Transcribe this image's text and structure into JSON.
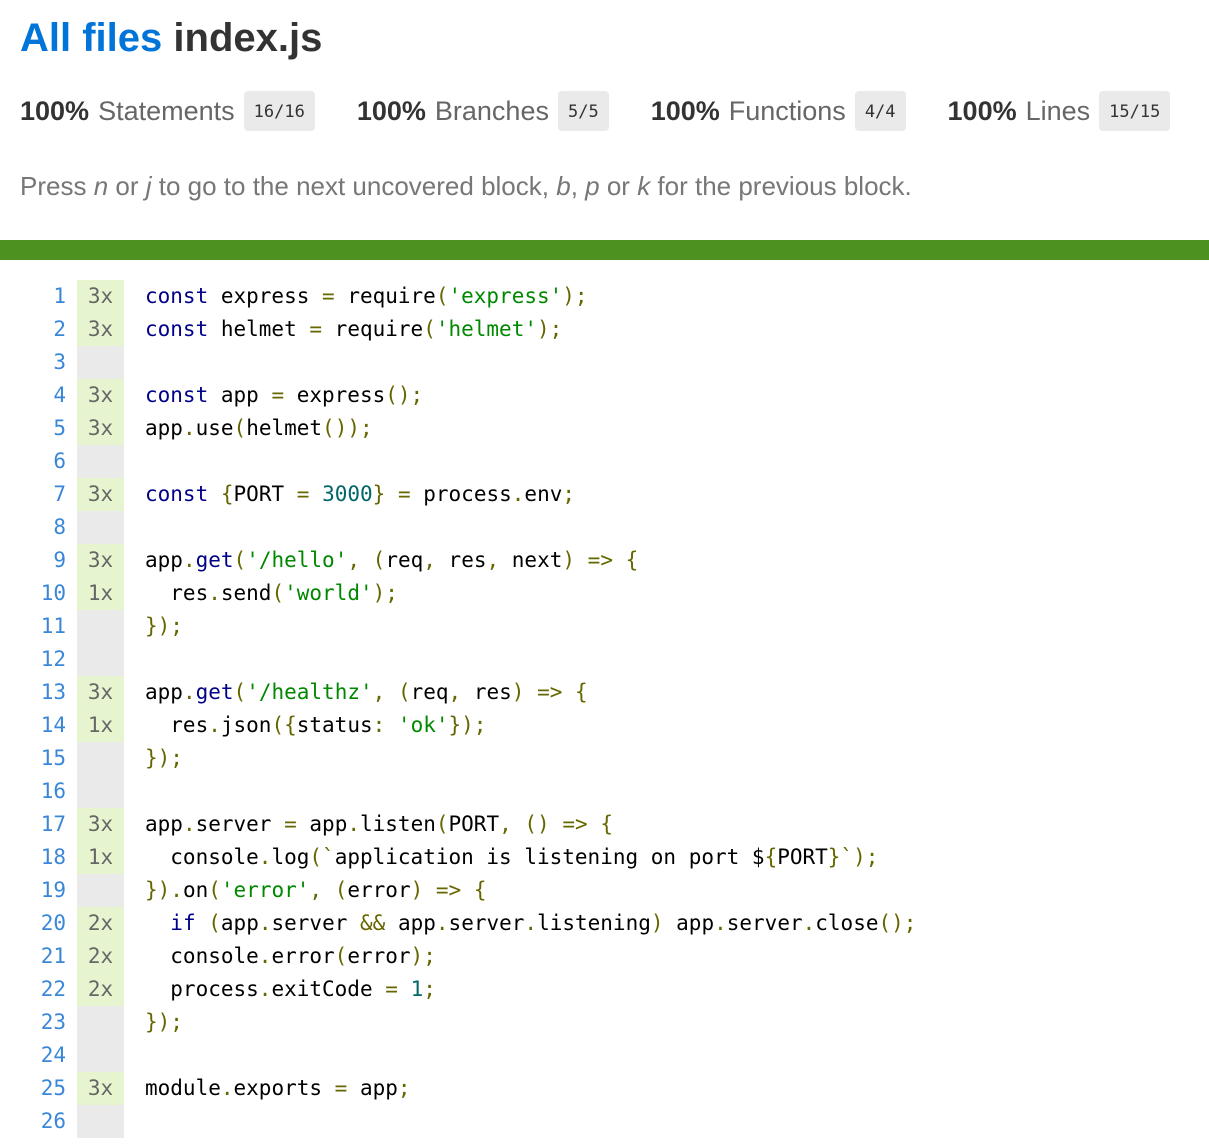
{
  "header": {
    "breadcrumb_link": "All files",
    "file_name": "index.js"
  },
  "summary": [
    {
      "percent": "100%",
      "label": "Statements",
      "fraction": "16/16"
    },
    {
      "percent": "100%",
      "label": "Branches",
      "fraction": "5/5"
    },
    {
      "percent": "100%",
      "label": "Functions",
      "fraction": "4/4"
    },
    {
      "percent": "100%",
      "label": "Lines",
      "fraction": "15/15"
    }
  ],
  "hint": {
    "p1": "Press ",
    "k1": "n",
    "p2": " or ",
    "k2": "j",
    "p3": " to go to the next uncovered block, ",
    "k3": "b",
    "p4": ", ",
    "k4": "p",
    "p5": " or ",
    "k5": "k",
    "p6": " for the previous block."
  },
  "colors": {
    "link": "#0074D9",
    "status_high": "#4d9221",
    "covered_bg": "#e6f5d0",
    "neutral_bg": "#eaeaea"
  },
  "code_lines": [
    {
      "n": "1",
      "hits": "3x",
      "tokens": [
        [
          "kw",
          "const"
        ],
        [
          "t",
          " express "
        ],
        [
          "pun",
          "="
        ],
        [
          "t",
          " require"
        ],
        [
          "pun",
          "("
        ],
        [
          "str",
          "'express'"
        ],
        [
          "pun",
          ");"
        ]
      ]
    },
    {
      "n": "2",
      "hits": "3x",
      "tokens": [
        [
          "kw",
          "const"
        ],
        [
          "t",
          " helmet "
        ],
        [
          "pun",
          "="
        ],
        [
          "t",
          " require"
        ],
        [
          "pun",
          "("
        ],
        [
          "str",
          "'helmet'"
        ],
        [
          "pun",
          ");"
        ]
      ]
    },
    {
      "n": "3",
      "hits": "",
      "tokens": []
    },
    {
      "n": "4",
      "hits": "3x",
      "tokens": [
        [
          "kw",
          "const"
        ],
        [
          "t",
          " app "
        ],
        [
          "pun",
          "="
        ],
        [
          "t",
          " express"
        ],
        [
          "pun",
          "();"
        ]
      ]
    },
    {
      "n": "5",
      "hits": "3x",
      "tokens": [
        [
          "t",
          "app"
        ],
        [
          "pun",
          "."
        ],
        [
          "t",
          "use"
        ],
        [
          "pun",
          "("
        ],
        [
          "t",
          "helmet"
        ],
        [
          "pun",
          "());"
        ]
      ]
    },
    {
      "n": "6",
      "hits": "",
      "tokens": []
    },
    {
      "n": "7",
      "hits": "3x",
      "tokens": [
        [
          "kw",
          "const"
        ],
        [
          "t",
          " "
        ],
        [
          "pun",
          "{"
        ],
        [
          "t",
          "PORT "
        ],
        [
          "pun",
          "="
        ],
        [
          "t",
          " "
        ],
        [
          "num",
          "3000"
        ],
        [
          "pun",
          "}"
        ],
        [
          "t",
          " "
        ],
        [
          "pun",
          "="
        ],
        [
          "t",
          " process"
        ],
        [
          "pun",
          "."
        ],
        [
          "t",
          "env"
        ],
        [
          "pun",
          ";"
        ]
      ]
    },
    {
      "n": "8",
      "hits": "",
      "tokens": []
    },
    {
      "n": "9",
      "hits": "3x",
      "tokens": [
        [
          "t",
          "app"
        ],
        [
          "pun",
          "."
        ],
        [
          "kw",
          "get"
        ],
        [
          "pun",
          "("
        ],
        [
          "str",
          "'/hello'"
        ],
        [
          "pun",
          ","
        ],
        [
          "t",
          " "
        ],
        [
          "pun",
          "("
        ],
        [
          "t",
          "req"
        ],
        [
          "pun",
          ","
        ],
        [
          "t",
          " res"
        ],
        [
          "pun",
          ","
        ],
        [
          "t",
          " next"
        ],
        [
          "pun",
          ")"
        ],
        [
          "t",
          " "
        ],
        [
          "pun",
          "=>"
        ],
        [
          "t",
          " "
        ],
        [
          "pun",
          "{"
        ]
      ]
    },
    {
      "n": "10",
      "hits": "1x",
      "tokens": [
        [
          "t",
          "  res"
        ],
        [
          "pun",
          "."
        ],
        [
          "t",
          "send"
        ],
        [
          "pun",
          "("
        ],
        [
          "str",
          "'world'"
        ],
        [
          "pun",
          ");"
        ]
      ]
    },
    {
      "n": "11",
      "hits": "",
      "tokens": [
        [
          "pun",
          "});"
        ]
      ]
    },
    {
      "n": "12",
      "hits": "",
      "tokens": []
    },
    {
      "n": "13",
      "hits": "3x",
      "tokens": [
        [
          "t",
          "app"
        ],
        [
          "pun",
          "."
        ],
        [
          "kw",
          "get"
        ],
        [
          "pun",
          "("
        ],
        [
          "str",
          "'/healthz'"
        ],
        [
          "pun",
          ","
        ],
        [
          "t",
          " "
        ],
        [
          "pun",
          "("
        ],
        [
          "t",
          "req"
        ],
        [
          "pun",
          ","
        ],
        [
          "t",
          " res"
        ],
        [
          "pun",
          ")"
        ],
        [
          "t",
          " "
        ],
        [
          "pun",
          "=>"
        ],
        [
          "t",
          " "
        ],
        [
          "pun",
          "{"
        ]
      ]
    },
    {
      "n": "14",
      "hits": "1x",
      "tokens": [
        [
          "t",
          "  res"
        ],
        [
          "pun",
          "."
        ],
        [
          "t",
          "json"
        ],
        [
          "pun",
          "({"
        ],
        [
          "t",
          "status"
        ],
        [
          "pun",
          ":"
        ],
        [
          "t",
          " "
        ],
        [
          "str",
          "'ok'"
        ],
        [
          "pun",
          "});"
        ]
      ]
    },
    {
      "n": "15",
      "hits": "",
      "tokens": [
        [
          "pun",
          "});"
        ]
      ]
    },
    {
      "n": "16",
      "hits": "",
      "tokens": []
    },
    {
      "n": "17",
      "hits": "3x",
      "tokens": [
        [
          "t",
          "app"
        ],
        [
          "pun",
          "."
        ],
        [
          "t",
          "server "
        ],
        [
          "pun",
          "="
        ],
        [
          "t",
          " app"
        ],
        [
          "pun",
          "."
        ],
        [
          "t",
          "listen"
        ],
        [
          "pun",
          "("
        ],
        [
          "t",
          "PORT"
        ],
        [
          "pun",
          ","
        ],
        [
          "t",
          " "
        ],
        [
          "pun",
          "()"
        ],
        [
          "t",
          " "
        ],
        [
          "pun",
          "=>"
        ],
        [
          "t",
          " "
        ],
        [
          "pun",
          "{"
        ]
      ]
    },
    {
      "n": "18",
      "hits": "1x",
      "tokens": [
        [
          "t",
          "  console"
        ],
        [
          "pun",
          "."
        ],
        [
          "t",
          "log"
        ],
        [
          "pun",
          "(`"
        ],
        [
          "t",
          "application is listening on port $"
        ],
        [
          "pun",
          "{"
        ],
        [
          "t",
          "PORT"
        ],
        [
          "pun",
          "}`);"
        ]
      ]
    },
    {
      "n": "19",
      "hits": "",
      "tokens": [
        [
          "pun",
          "})."
        ],
        [
          "t",
          "on"
        ],
        [
          "pun",
          "("
        ],
        [
          "str",
          "'error'"
        ],
        [
          "pun",
          ","
        ],
        [
          "t",
          " "
        ],
        [
          "pun",
          "("
        ],
        [
          "t",
          "error"
        ],
        [
          "pun",
          ")"
        ],
        [
          "t",
          " "
        ],
        [
          "pun",
          "=>"
        ],
        [
          "t",
          " "
        ],
        [
          "pun",
          "{"
        ]
      ]
    },
    {
      "n": "20",
      "hits": "2x",
      "tokens": [
        [
          "t",
          "  "
        ],
        [
          "kw",
          "if"
        ],
        [
          "t",
          " "
        ],
        [
          "pun",
          "("
        ],
        [
          "t",
          "app"
        ],
        [
          "pun",
          "."
        ],
        [
          "t",
          "server "
        ],
        [
          "pun",
          "&&"
        ],
        [
          "t",
          " app"
        ],
        [
          "pun",
          "."
        ],
        [
          "t",
          "server"
        ],
        [
          "pun",
          "."
        ],
        [
          "t",
          "listening"
        ],
        [
          "pun",
          ")"
        ],
        [
          "t",
          " app"
        ],
        [
          "pun",
          "."
        ],
        [
          "t",
          "server"
        ],
        [
          "pun",
          "."
        ],
        [
          "t",
          "close"
        ],
        [
          "pun",
          "();"
        ]
      ]
    },
    {
      "n": "21",
      "hits": "2x",
      "tokens": [
        [
          "t",
          "  console"
        ],
        [
          "pun",
          "."
        ],
        [
          "t",
          "error"
        ],
        [
          "pun",
          "("
        ],
        [
          "t",
          "error"
        ],
        [
          "pun",
          ");"
        ]
      ]
    },
    {
      "n": "22",
      "hits": "2x",
      "tokens": [
        [
          "t",
          "  process"
        ],
        [
          "pun",
          "."
        ],
        [
          "t",
          "exitCode "
        ],
        [
          "pun",
          "="
        ],
        [
          "t",
          " "
        ],
        [
          "num",
          "1"
        ],
        [
          "pun",
          ";"
        ]
      ]
    },
    {
      "n": "23",
      "hits": "",
      "tokens": [
        [
          "pun",
          "});"
        ]
      ]
    },
    {
      "n": "24",
      "hits": "",
      "tokens": []
    },
    {
      "n": "25",
      "hits": "3x",
      "tokens": [
        [
          "t",
          "module"
        ],
        [
          "pun",
          "."
        ],
        [
          "t",
          "exports "
        ],
        [
          "pun",
          "="
        ],
        [
          "t",
          " app"
        ],
        [
          "pun",
          ";"
        ]
      ]
    },
    {
      "n": "26",
      "hits": "",
      "tokens": []
    }
  ]
}
